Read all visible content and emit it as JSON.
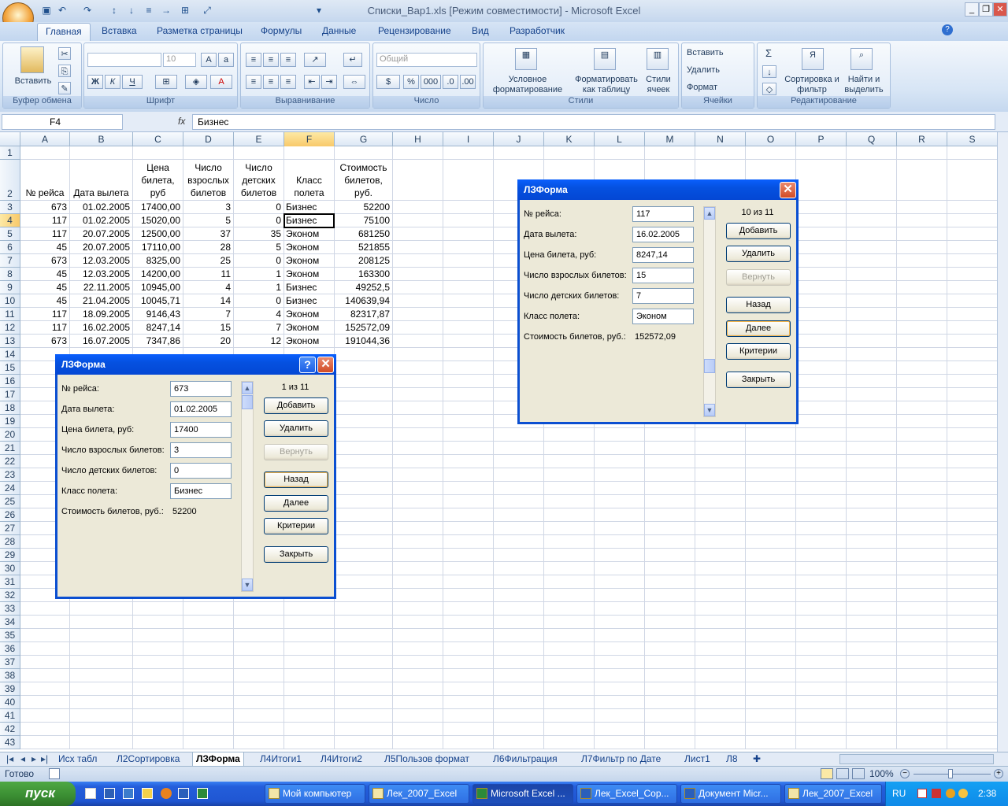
{
  "window": {
    "title": "Списки_Вар1.xls  [Режим совместимости]  - Microsoft Excel"
  },
  "ribbon": {
    "tabs": [
      "Главная",
      "Вставка",
      "Разметка страницы",
      "Формулы",
      "Данные",
      "Рецензирование",
      "Вид",
      "Разработчик"
    ],
    "clipboard": {
      "paste": "Вставить",
      "label": "Буфер обмена"
    },
    "font": {
      "size": "10",
      "label": "Шрифт",
      "bold": "Ж",
      "italic": "К",
      "underline": "Ч"
    },
    "alignment": {
      "label": "Выравнивание"
    },
    "number": {
      "format": "Общий",
      "label": "Число",
      "percent": "%",
      "thousands": "000"
    },
    "styles": {
      "cond": "Условное форматирование",
      "table": "Форматировать как таблицу",
      "cell": "Стили ячеек",
      "label": "Стили"
    },
    "cells": {
      "insert": "Вставить",
      "delete": "Удалить",
      "format": "Формат",
      "label": "Ячейки"
    },
    "editing": {
      "sigma": "Σ",
      "sort": "Сортировка и фильтр",
      "find": "Найти и выделить",
      "label": "Редактирование"
    }
  },
  "formula_bar": {
    "name_box": "F4",
    "fx": "fx",
    "value": "Бизнес"
  },
  "columns": [
    "A",
    "B",
    "C",
    "D",
    "E",
    "F",
    "G",
    "H",
    "I",
    "J",
    "K",
    "L",
    "M",
    "N",
    "O",
    "P",
    "Q",
    "R",
    "S"
  ],
  "rows": [
    "1",
    "2",
    "3",
    "4",
    "5",
    "6",
    "7",
    "8",
    "9",
    "10",
    "11",
    "12",
    "13",
    "14",
    "15",
    "16",
    "17",
    "18",
    "19",
    "20",
    "21",
    "22",
    "23",
    "24",
    "25",
    "26",
    "27",
    "28",
    "29",
    "30",
    "31",
    "32",
    "33",
    "34",
    "35",
    "36",
    "37",
    "38",
    "39",
    "40",
    "41",
    "42",
    "43"
  ],
  "table": {
    "headers": [
      "№ рейса",
      "Дата вылета",
      "Цена билета, руб",
      "Число взрослых билетов",
      "Число детских билетов",
      "Класс полета",
      "Стоимость билетов, руб."
    ],
    "data": [
      [
        "673",
        "01.02.2005",
        "17400,00",
        "3",
        "0",
        "Бизнес",
        "52200"
      ],
      [
        "117",
        "01.02.2005",
        "15020,00",
        "5",
        "0",
        "Бизнес",
        "75100"
      ],
      [
        "117",
        "20.07.2005",
        "12500,00",
        "37",
        "35",
        "Эконом",
        "681250"
      ],
      [
        "45",
        "20.07.2005",
        "17110,00",
        "28",
        "5",
        "Эконом",
        "521855"
      ],
      [
        "673",
        "12.03.2005",
        "8325,00",
        "25",
        "0",
        "Эконом",
        "208125"
      ],
      [
        "45",
        "12.03.2005",
        "14200,00",
        "11",
        "1",
        "Эконом",
        "163300"
      ],
      [
        "45",
        "22.11.2005",
        "10945,00",
        "4",
        "1",
        "Бизнес",
        "49252,5"
      ],
      [
        "45",
        "21.04.2005",
        "10045,71",
        "14",
        "0",
        "Бизнес",
        "140639,94"
      ],
      [
        "117",
        "18.09.2005",
        "9146,43",
        "7",
        "4",
        "Эконом",
        "82317,87"
      ],
      [
        "117",
        "16.02.2005",
        "8247,14",
        "15",
        "7",
        "Эконом",
        "152572,09"
      ],
      [
        "673",
        "16.07.2005",
        "7347,86",
        "20",
        "12",
        "Эконом",
        "191044,36"
      ]
    ]
  },
  "dialog_labels": {
    "flight": "№ рейса:",
    "date": "Дата вылета:",
    "price": "Цена билета, руб:",
    "adults": "Число взрослых билетов:",
    "kids": "Число детских билетов:",
    "class": "Класс полета:",
    "cost": "Стоимость билетов, руб.:"
  },
  "dialog_buttons": {
    "add": "Добавить",
    "delete": "Удалить",
    "restore": "Вернуть",
    "back": "Назад",
    "next": "Далее",
    "criteria": "Критерии",
    "close": "Закрыть"
  },
  "dialog1": {
    "title": "ЛЗФорма",
    "help": "?",
    "close": "✕",
    "counter": "1 из 11",
    "flight": "673",
    "date": "01.02.2005",
    "price": "17400",
    "adults": "3",
    "kids": "0",
    "class": "Бизнес",
    "cost": "52200"
  },
  "dialog2": {
    "title": "ЛЗФорма",
    "close": "✕",
    "counter": "10 из 11",
    "flight": "117",
    "date": "16.02.2005",
    "price": "8247,14",
    "adults": "15",
    "kids": "7",
    "class": "Эконом",
    "cost": "152572,09"
  },
  "sheets": [
    "Исх табл",
    "Л2Сортировка",
    "ЛЗФорма",
    "Л4Итоги1",
    "Л4Итоги2",
    "Л5Пользов формат",
    "Л6Фильтрация",
    "Л7Фильтр по Дате",
    "Лист1",
    "Л8"
  ],
  "status": {
    "ready": "Готово",
    "zoom": "100%"
  },
  "taskbar": {
    "start": "пуск",
    "items": [
      "Мой компьютер",
      "Лек_2007_Excel",
      "Microsoft Excel ...",
      "Лек_Excel_Сор...",
      "Документ Micr...",
      "Лек_2007_Excel"
    ],
    "lang": "RU",
    "time": "2:38"
  }
}
